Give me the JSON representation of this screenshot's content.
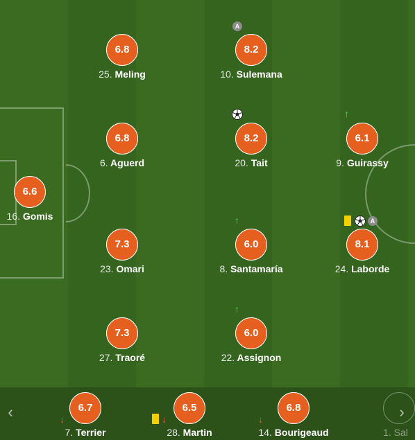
{
  "players": [
    {
      "id": "meling",
      "number": "25.",
      "name": "Meling",
      "rating": "6.8"
    },
    {
      "id": "sulemana",
      "number": "10.",
      "name": "Sulemana",
      "rating": "8.2"
    },
    {
      "id": "aguerd",
      "number": "6.",
      "name": "Aguerd",
      "rating": "6.8"
    },
    {
      "id": "tait",
      "number": "20.",
      "name": "Tait",
      "rating": "8.2"
    },
    {
      "id": "guirassy",
      "number": "9.",
      "name": "Guirassy",
      "rating": "6.1"
    },
    {
      "id": "gomis",
      "number": "16.",
      "name": "Gomis",
      "rating": "6.6"
    },
    {
      "id": "omari",
      "number": "23.",
      "name": "Omari",
      "rating": "7.3"
    },
    {
      "id": "santamaria",
      "number": "8.",
      "name": "Santamaría",
      "rating": "6.0"
    },
    {
      "id": "laborde",
      "number": "24.",
      "name": "Laborde",
      "rating": "8.1"
    },
    {
      "id": "traore",
      "number": "27.",
      "name": "Traoré",
      "rating": "7.3"
    },
    {
      "id": "assignon",
      "number": "22.",
      "name": "Assignon",
      "rating": "6.0"
    }
  ],
  "bench": [
    {
      "id": "terrier",
      "number": "7.",
      "name": "Terrier",
      "rating": "6.7"
    },
    {
      "id": "martin",
      "number": "28.",
      "name": "Martin",
      "rating": "6.5"
    },
    {
      "id": "bourigeaud",
      "number": "14.",
      "name": "Bourigeaud",
      "rating": "6.8"
    }
  ],
  "bench_partial": {
    "text": "1. Sal"
  },
  "icons": {
    "captain_label": "A",
    "goal_icon": "soccer-ball-icon",
    "sub_in_icon": "arrow-up-icon",
    "sub_out_icon": "arrow-down-icon",
    "card_icon": "yellow-card-icon",
    "up_glyph": "↑",
    "down_glyph": "↓",
    "prev_glyph": "‹",
    "next_glyph": "›"
  },
  "colors": {
    "rating_bg": "#e5601f",
    "sub_in": "#35e83a",
    "sub_out": "#ff4a3a",
    "yellow_card": "#f4d000"
  }
}
